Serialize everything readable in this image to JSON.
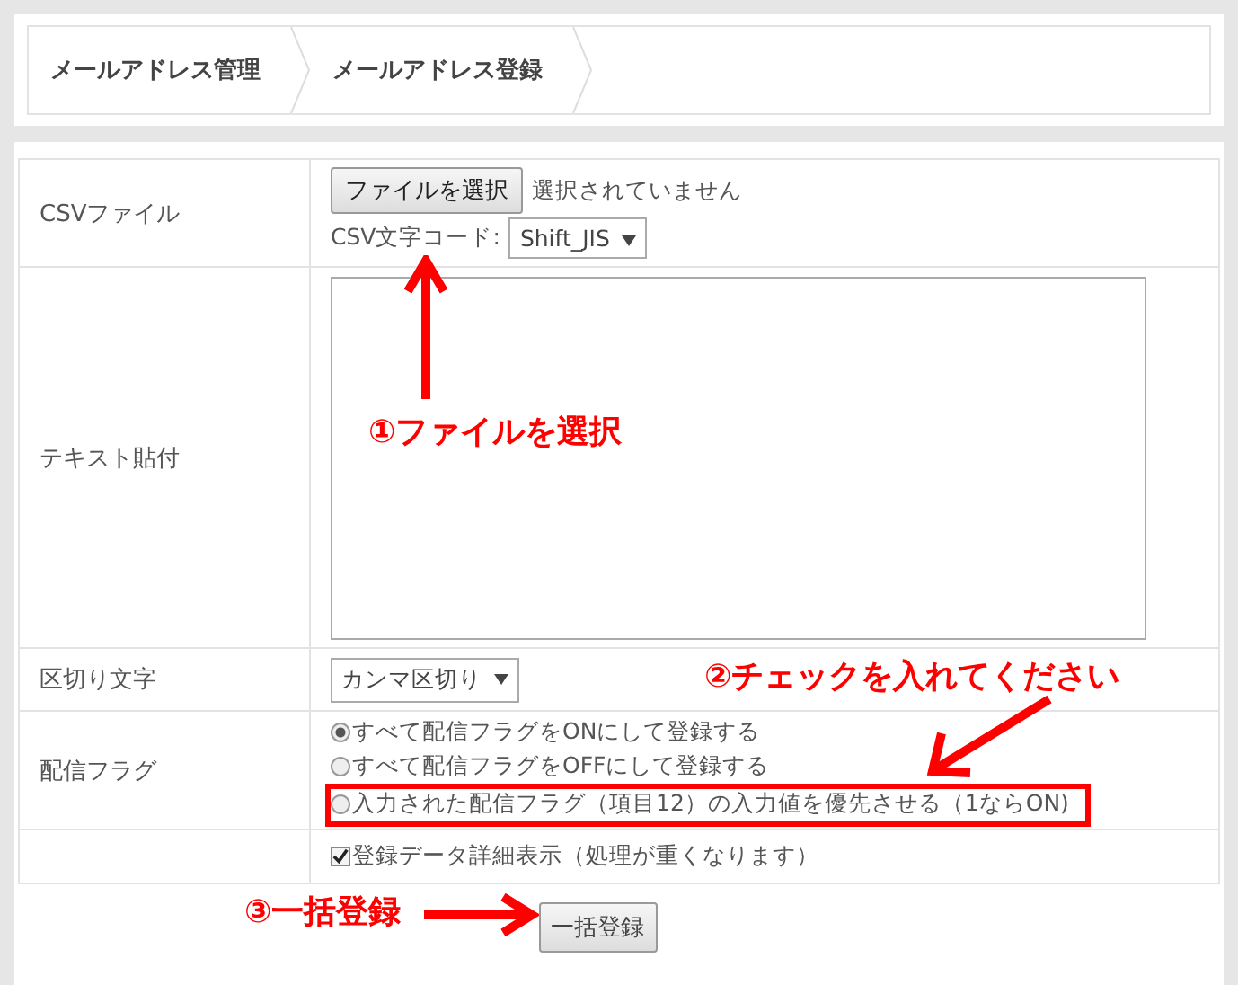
{
  "breadcrumb": [
    {
      "label": "メールアドレス管理"
    },
    {
      "label": "メールアドレス登録"
    }
  ],
  "form": {
    "rows": [
      {
        "kind": "file",
        "label": "CSVファイル",
        "button": "ファイルを選択",
        "status": "選択されていません",
        "encoding_label": "CSV文字コード:",
        "encoding": "Shift_JIS"
      },
      {
        "kind": "textarea",
        "label": "テキスト貼付"
      },
      {
        "kind": "select",
        "label": "区切り文字",
        "value": "カンマ区切り"
      },
      {
        "kind": "radios",
        "label": "配信フラグ",
        "options": [
          {
            "label": "すべて配信フラグをONにして登録する",
            "selected": true,
            "highlighted": false
          },
          {
            "label": "すべて配信フラグをOFFにして登録する",
            "selected": false,
            "highlighted": false
          },
          {
            "label": "入力された配信フラグ（項目12）の入力値を優先させる（1ならON)",
            "selected": false,
            "highlighted": true
          }
        ]
      },
      {
        "kind": "checkbox",
        "label": "",
        "option": "登録データ詳細表示（処理が重くなります）",
        "checked": true
      }
    ],
    "submit": "一括登録"
  },
  "annotations": [
    {
      "text": "①ファイルを選択"
    },
    {
      "text": "②チェックを入れてください"
    },
    {
      "text": "③一括登録"
    }
  ]
}
